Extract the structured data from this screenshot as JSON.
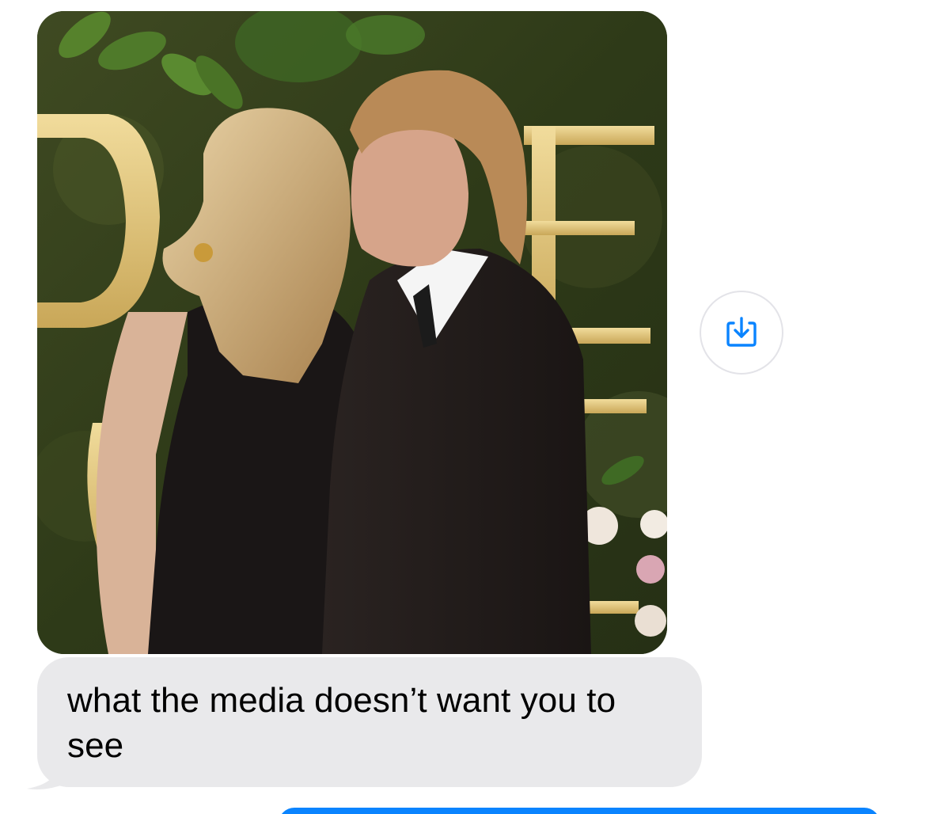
{
  "conversation": {
    "incoming_image_message": {
      "kind": "photo",
      "save_icon": "download-into-tray-icon"
    },
    "incoming_text_message": {
      "text": "what the media doesn’t want you to see"
    },
    "outgoing_message_partial": {
      "text": ""
    }
  },
  "colors": {
    "incoming_bubble": "#e9e9eb",
    "outgoing_bubble": "#0a84ff",
    "accent_icon": "#0a84ff",
    "save_button_border": "#e3e3e8"
  }
}
